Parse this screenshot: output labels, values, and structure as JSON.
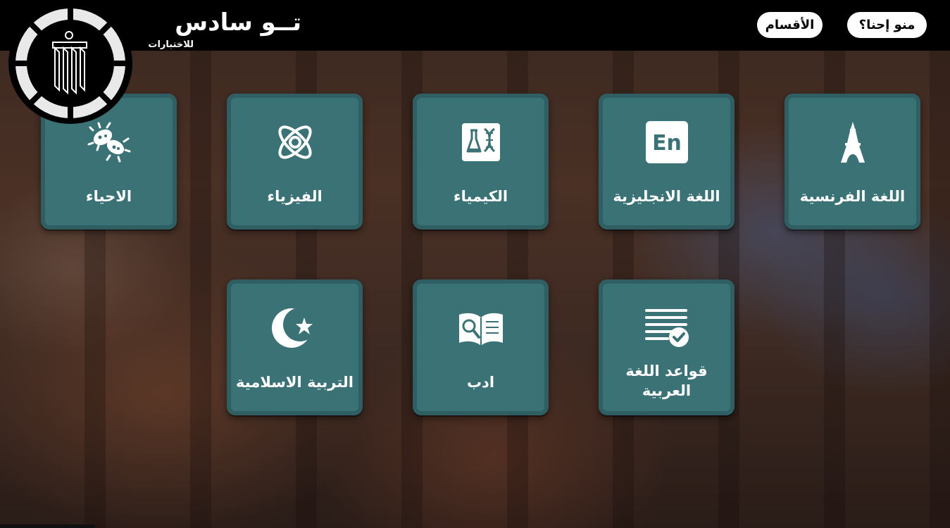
{
  "brand": {
    "title": "تــو سادس",
    "subtitle": "للاختبارات"
  },
  "nav": {
    "about_label": "منو إحنا؟",
    "sections_label": "الأقسام"
  },
  "subjects": [
    {
      "label": "اللغة الفرنسية",
      "icon": "eiffel-tower-icon"
    },
    {
      "label": "اللغة الانجليزية",
      "icon": "english-en-icon"
    },
    {
      "label": "الكيمياء",
      "icon": "chemistry-flask-dna-icon"
    },
    {
      "label": "الفيزياء",
      "icon": "atom-icon"
    },
    {
      "label": "الاحياء",
      "icon": "bacteria-icon"
    },
    {
      "label": "قواعد اللغة العربية",
      "icon": "document-check-icon"
    },
    {
      "label": "ادب",
      "icon": "book-magnifier-icon"
    },
    {
      "label": "التربية الاسلامية",
      "icon": "crescent-star-icon"
    }
  ],
  "colors": {
    "card_bg": "#3a7276",
    "card_border": "#2f5f62",
    "header_bg": "#000000",
    "nav_button_bg": "#ffffff"
  }
}
